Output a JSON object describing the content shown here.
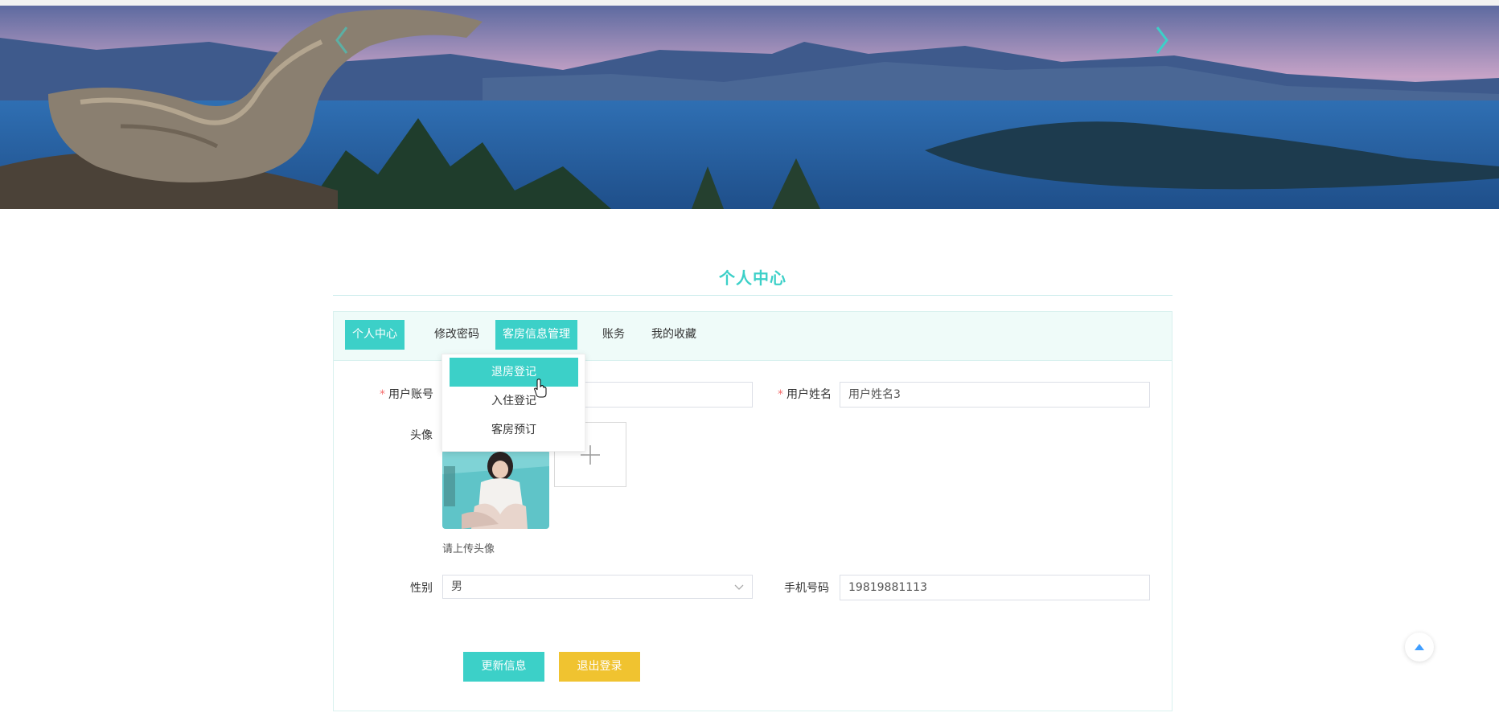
{
  "page": {
    "section_title": "个人中心"
  },
  "tabs": [
    {
      "label": "个人中心"
    },
    {
      "label": "修改密码"
    },
    {
      "label": "客房信息管理"
    },
    {
      "label": "账务"
    },
    {
      "label": "我的收藏"
    }
  ],
  "dropdown": {
    "items": [
      {
        "label": "退房登记"
      },
      {
        "label": "入住登记"
      },
      {
        "label": "客房预订"
      }
    ]
  },
  "form": {
    "account_label": "用户账号",
    "account_value": "",
    "name_label": "用户姓名",
    "name_value": "用户姓名3",
    "avatar_label": "头像",
    "avatar_hint": "请上传头像",
    "gender_label": "性别",
    "gender_value": "男",
    "phone_label": "手机号码",
    "phone_value": "19819881113"
  },
  "buttons": {
    "update": "更新信息",
    "logout": "退出登录"
  },
  "icons": {
    "banner_prev": "chevron-left-icon",
    "banner_next": "chevron-right-icon",
    "upload": "plus-icon",
    "select": "chevron-down-icon",
    "back_to_top": "caret-up-icon",
    "cursor": "hand-pointer-icon"
  },
  "colors": {
    "accent": "#3cd0c8",
    "warning": "#f0c330",
    "required": "#f56c6c"
  }
}
